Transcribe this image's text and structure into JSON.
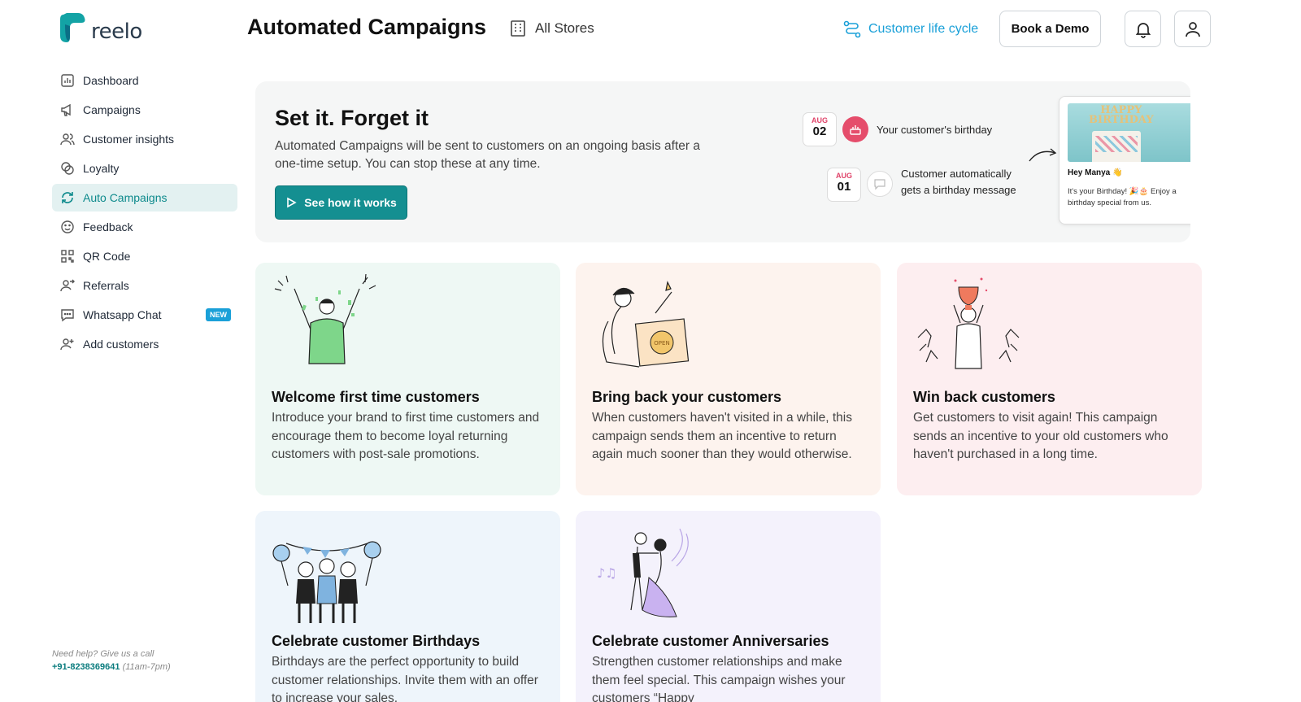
{
  "brand": {
    "name": "reelo",
    "accent": "#148f91",
    "link": "#1aa0d8"
  },
  "sidebar": {
    "items": [
      {
        "label": "Dashboard",
        "icon": "chart-icon"
      },
      {
        "label": "Campaigns",
        "icon": "megaphone-icon"
      },
      {
        "label": "Customer insights",
        "icon": "users-icon"
      },
      {
        "label": "Loyalty",
        "icon": "coins-icon"
      },
      {
        "label": "Auto Campaigns",
        "icon": "refresh-icon",
        "active": true
      },
      {
        "label": "Feedback",
        "icon": "smiley-icon"
      },
      {
        "label": "QR Code",
        "icon": "qr-icon"
      },
      {
        "label": "Referrals",
        "icon": "referral-icon"
      },
      {
        "label": "Whatsapp Chat",
        "icon": "chat-icon",
        "badge": "NEW"
      },
      {
        "label": "Add customers",
        "icon": "add-user-icon"
      }
    ],
    "help": {
      "question": "Need help? Give us a call",
      "phone": "+91-8238369641",
      "hours": "(11am-7pm)"
    }
  },
  "header": {
    "title": "Automated Campaigns",
    "store": "All Stores",
    "lifecycle_link": "Customer life cycle",
    "demo_button": "Book a Demo"
  },
  "hero": {
    "title": "Set it. Forget it",
    "description": "Automated Campaigns will be sent to customers on an ongoing basis after a one-time setup. You can stop these at any time.",
    "button": "See how it works",
    "event1": {
      "month": "AUG",
      "day": "02",
      "text": "Your customer's birthday"
    },
    "event2": {
      "month": "AUG",
      "day": "01",
      "text_line1": "Customer automatically",
      "text_line2": "gets a birthday message"
    },
    "message": {
      "image_text_1": "HAPPY",
      "image_text_2": "BIRTHDAY",
      "greeting": "Hey Manya 👋",
      "body": "It's your Birthday! 🎉🎂 Enjoy a birthday special from us."
    }
  },
  "cards": [
    {
      "title": "Welcome first time customers",
      "description": "Introduce your brand to first time customers and encourage them to become loyal returning customers with post-sale promotions."
    },
    {
      "title": "Bring back your customers",
      "description": "When customers haven't visited in a while, this campaign sends them an incentive to return again much sooner than they would otherwise."
    },
    {
      "title": "Win back customers",
      "description": "Get customers to visit again! This campaign sends an incentive to your old customers who haven't purchased in a long time."
    },
    {
      "title": "Celebrate customer Birthdays",
      "description": "Birthdays are the perfect opportunity to build customer relationships. Invite them with an offer to increase your sales."
    },
    {
      "title": "Celebrate customer Anniversaries",
      "description": "Strengthen customer relationships and make them feel special. This campaign wishes your customers “Happy"
    }
  ]
}
